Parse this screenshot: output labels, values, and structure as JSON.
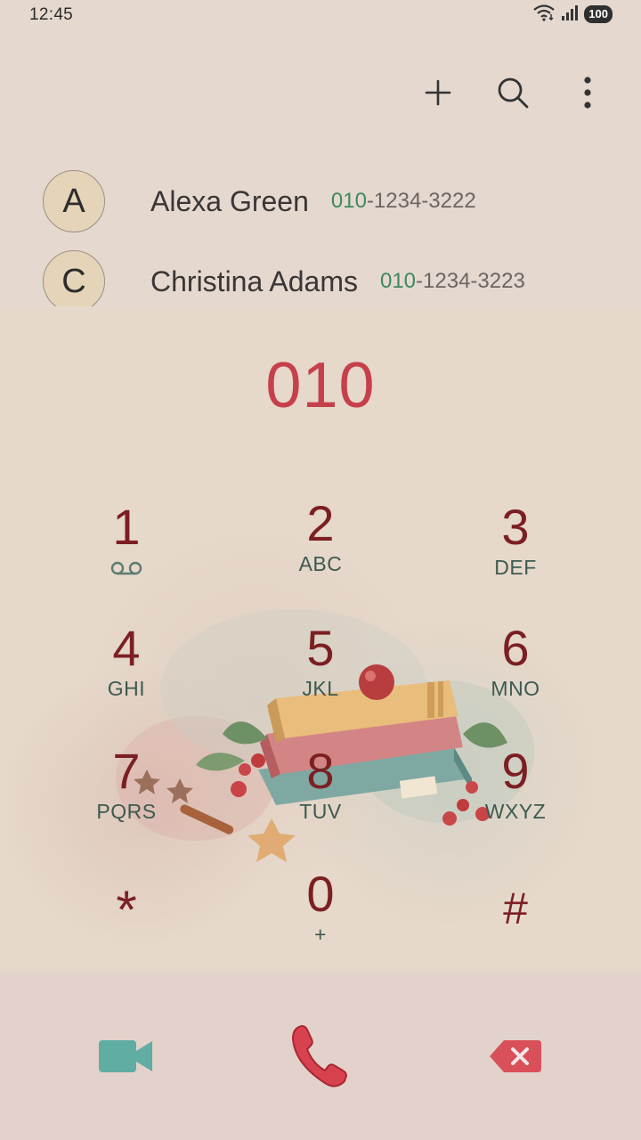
{
  "status_bar": {
    "time": "12:45",
    "battery": "100",
    "icons": [
      "wifi-icon",
      "signal-icon",
      "battery-icon"
    ]
  },
  "toolbar": {
    "icons": [
      "add-icon",
      "search-icon",
      "more-options-icon"
    ]
  },
  "contacts": [
    {
      "initial": "A",
      "name": "Alexa Green",
      "number_match": "010",
      "number_rest": "-1234-3222"
    },
    {
      "initial": "C",
      "name": "Christina Adams",
      "number_match": "010",
      "number_rest": "-1234-3223"
    }
  ],
  "dialer": {
    "entered_number": "010",
    "keys": [
      {
        "digit": "1",
        "letters": "",
        "icon": "voicemail-icon"
      },
      {
        "digit": "2",
        "letters": "ABC"
      },
      {
        "digit": "3",
        "letters": "DEF"
      },
      {
        "digit": "4",
        "letters": "GHI"
      },
      {
        "digit": "5",
        "letters": "JKL"
      },
      {
        "digit": "6",
        "letters": "MNO"
      },
      {
        "digit": "7",
        "letters": "PQRS"
      },
      {
        "digit": "8",
        "letters": "TUV"
      },
      {
        "digit": "9",
        "letters": "WXYZ"
      },
      {
        "digit": "*",
        "letters": ""
      },
      {
        "digit": "0",
        "letters": "+"
      },
      {
        "digit": "#",
        "letters": ""
      }
    ]
  },
  "bottom_bar": {
    "icons": [
      "video-call-icon",
      "phone-call-icon",
      "backspace-icon"
    ]
  },
  "colors": {
    "accent_number": "#c5404a",
    "match_green": "#3d8a5e",
    "key_digit": "#7b1f22",
    "key_letters": "#3d5a50",
    "video_teal": "#5fada3",
    "call_red": "#d8414e",
    "delete_red": "#d9505a"
  }
}
